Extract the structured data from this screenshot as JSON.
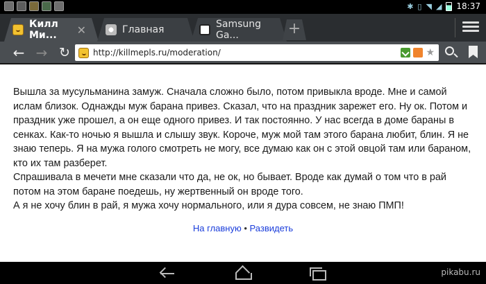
{
  "status_bar": {
    "time": "18:37",
    "icons": [
      "gallery-icon",
      "mail-icon",
      "app-icon",
      "android-icon",
      "store-icon"
    ]
  },
  "tabs": [
    {
      "title": "Килл Ми...",
      "favicon": "smiley-favicon",
      "active": true
    },
    {
      "title": "Главная",
      "favicon": "chrome-favicon",
      "active": false
    },
    {
      "title": "Samsung Ga...",
      "favicon": "samsung-favicon",
      "active": false
    }
  ],
  "toolbar": {
    "url": "http://killmepls.ru/moderation/",
    "omnibox_icons": [
      "download-icon",
      "rss-icon",
      "star-icon"
    ]
  },
  "article": {
    "paragraphs": [
      "Вышла за мусульманина замуж. Сначала сложно было, потом привыкла вроде. Мне и самой ислам близок. Однажды муж барана привез. Сказал, что на праздник зарежет его. Ну ок. Потом и праздник уже прошел, а он еще одного привез. И так постоянно. У нас всегда в доме бараны в сенках. Как-то ночью я вышла и слышу звук. Короче, муж мой там этого барана любит, блин. Я не знаю теперь. Я на мужа голого смотреть не могу, все думаю как он с этой овцой там или бараном, кто их там разберет.",
      "Спрашивала в мечети мне сказали что да, не ок, но бывает. Вроде как думай о том что в рай потом на этом баране поедешь, ну жертвенный он вроде того.",
      "А я не хочу блин в рай, я мужа хочу нормального, или я дура совсем, не знаю ПМП!"
    ],
    "links": {
      "home": "На главную",
      "separator": "•",
      "unsee": "Развидеть"
    }
  },
  "watermark": "pikabu.ru",
  "colors": {
    "tab_strip": "#2a2d30",
    "toolbar": "#4a4e52",
    "link": "#1a3ddb"
  }
}
